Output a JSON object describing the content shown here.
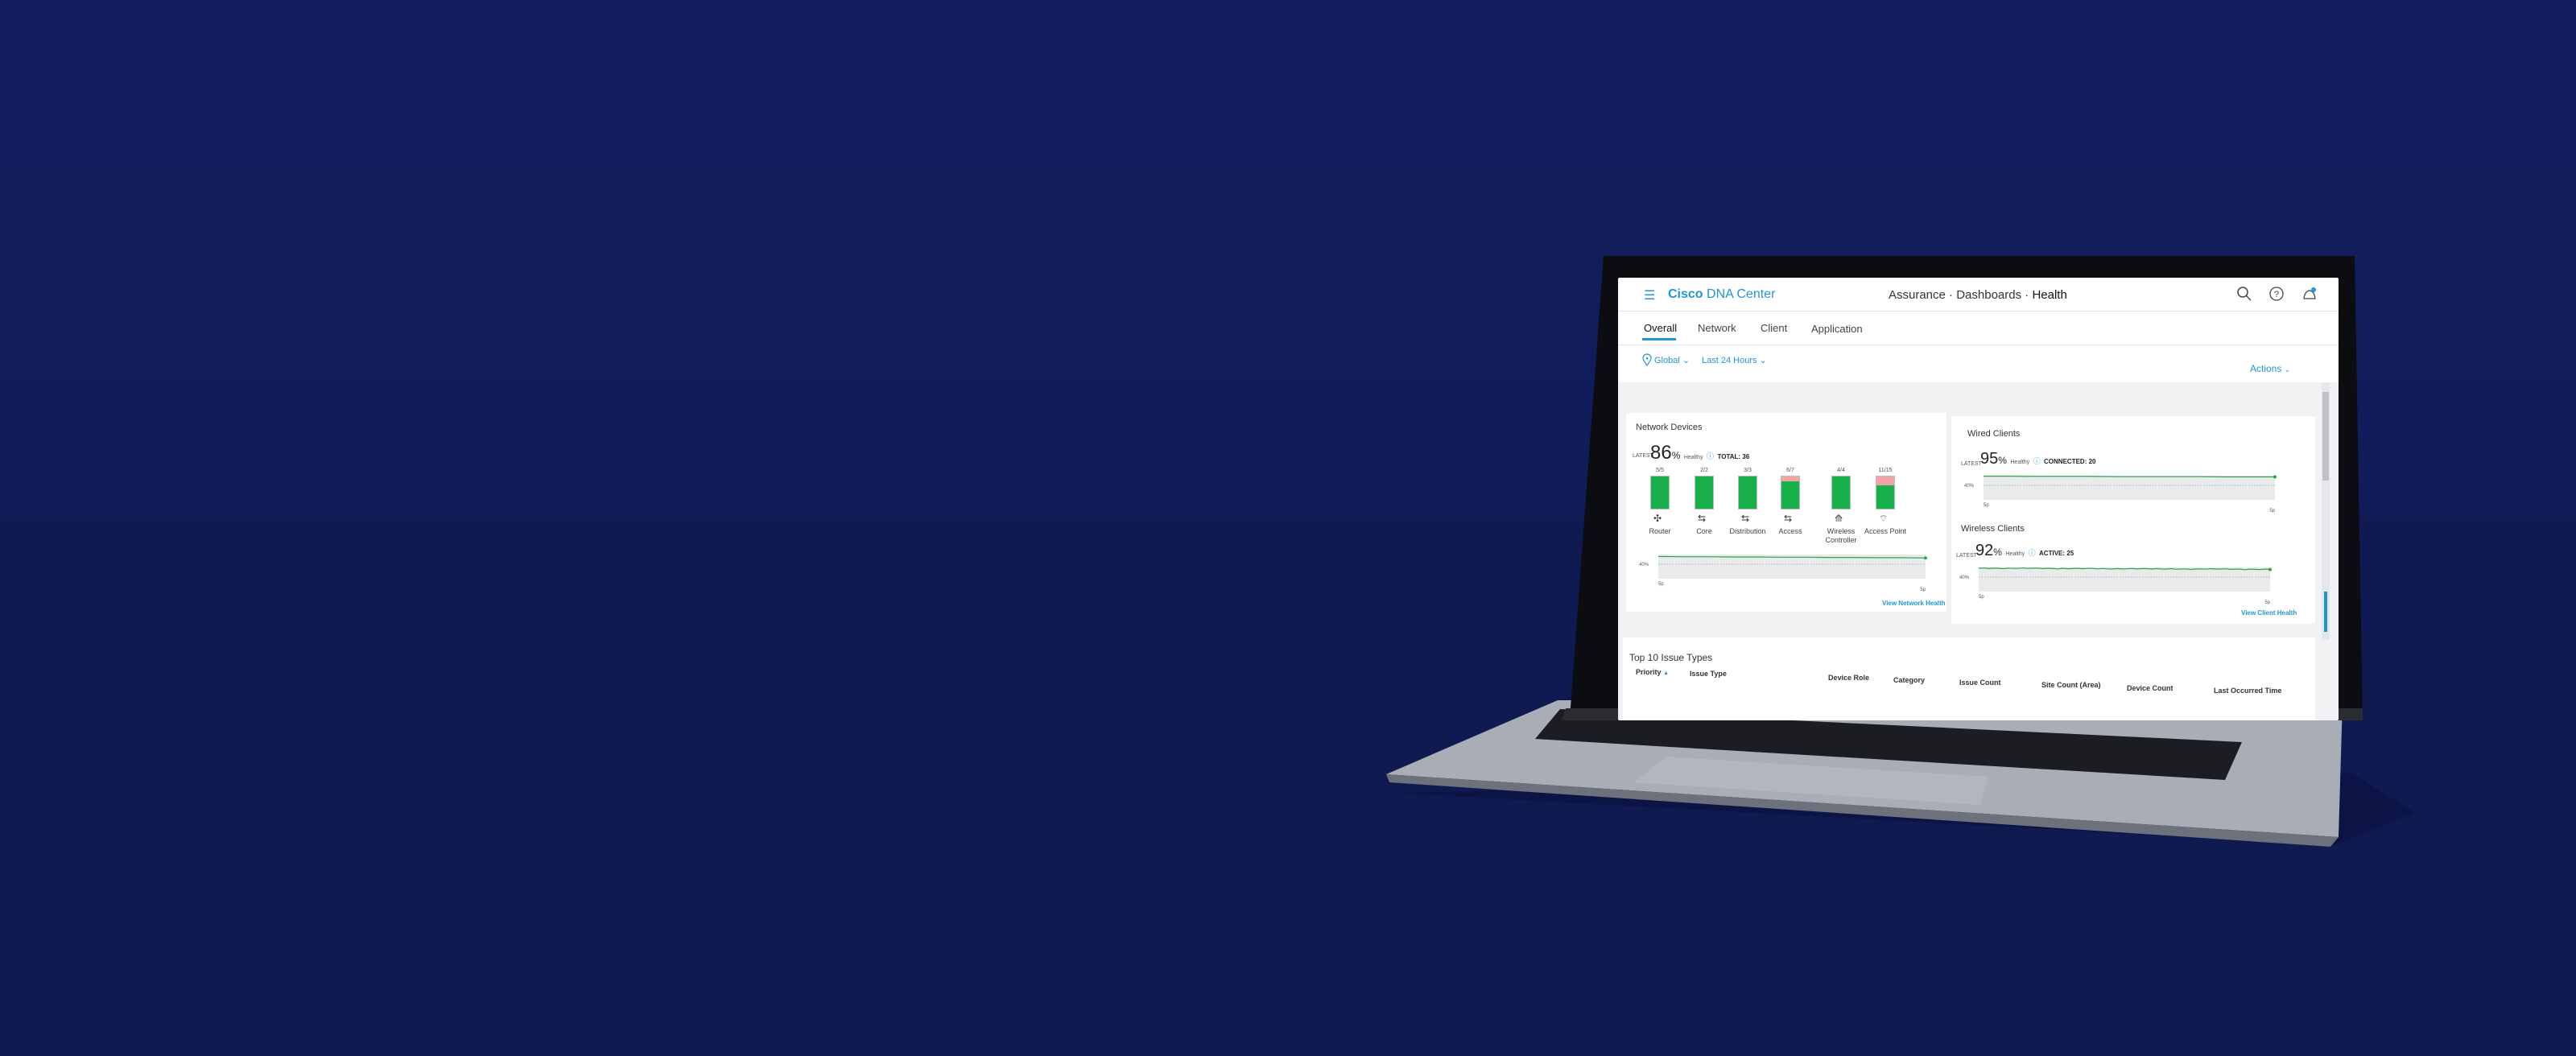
{
  "header": {
    "menu_icon": "hamburger-icon",
    "brand_bold": "Cisco",
    "brand_rest": "DNA Center",
    "breadcrumb": [
      "Assurance",
      "Dashboards",
      "Health"
    ],
    "breadcrumb_sep": "·",
    "icons": [
      "search-icon",
      "help-icon",
      "notification-icon"
    ]
  },
  "tabs": [
    {
      "label": "Overall",
      "active": true
    },
    {
      "label": "Network",
      "active": false
    },
    {
      "label": "Client",
      "active": false
    },
    {
      "label": "Application",
      "active": false
    }
  ],
  "filters": {
    "location": "Global",
    "time_range": "Last 24 Hours",
    "actions": "Actions"
  },
  "colors": {
    "accent": "#1e96d2",
    "healthy": "#18b04a",
    "unhealthy": "#f2a3a6",
    "background": "#121e5e"
  },
  "network_devices": {
    "title": "Network Devices",
    "latest_label": "LATEST",
    "health_value": "86",
    "percent_sign": "%",
    "healthy_label": "Healthy",
    "total": "TOTAL: 36",
    "categories": [
      {
        "label": "Router",
        "healthy": 5,
        "total": 5,
        "fraction": "5/5",
        "icon": "router-icon"
      },
      {
        "label": "Core",
        "healthy": 2,
        "total": 2,
        "fraction": "2/2",
        "icon": "switch-icon"
      },
      {
        "label": "Distribution",
        "healthy": 3,
        "total": 3,
        "fraction": "3/3",
        "icon": "switch-icon"
      },
      {
        "label": "Access",
        "healthy": 6,
        "total": 7,
        "fraction": "6/7",
        "icon": "switch-icon"
      },
      {
        "label": "Wireless Controller",
        "healthy": 4,
        "total": 4,
        "fraction": "4/4",
        "icon": "wireless-controller-icon"
      },
      {
        "label": "Access Point",
        "healthy": 11,
        "total": 15,
        "fraction": "11/15",
        "icon": "wifi-icon"
      }
    ],
    "trend": {
      "threshold_label": "40%",
      "start_label": "5p",
      "end_label": "5p",
      "values": [
        92,
        91,
        91,
        90,
        90,
        89,
        89,
        88,
        88,
        87,
        87,
        86
      ]
    },
    "link": "View Network Health"
  },
  "wired_clients": {
    "title": "Wired Clients",
    "latest_label": "LATEST",
    "health_value": "95",
    "percent_sign": "%",
    "healthy_label": "Healthy",
    "count": "CONNECTED: 20",
    "trend": {
      "threshold_label": "40%",
      "start_label": "5p",
      "end_label": "5p",
      "values": [
        98,
        98,
        97,
        97,
        97,
        96,
        96,
        96,
        96,
        95,
        95,
        95
      ]
    }
  },
  "wireless_clients": {
    "title": "Wireless Clients",
    "latest_label": "LATEST",
    "health_value": "92",
    "percent_sign": "%",
    "healthy_label": "Healthy",
    "count": "ACTIVE: 25",
    "trend": {
      "threshold_label": "40%",
      "start_label": "5p",
      "end_label": "5p",
      "values": [
        97,
        96,
        97,
        95,
        96,
        94,
        95,
        94,
        93,
        94,
        92,
        92
      ]
    },
    "link": "View Client Health"
  },
  "issues": {
    "title": "Top 10 Issue Types",
    "columns": [
      "Priority",
      "Issue Type",
      "Device Role",
      "Category",
      "Issue Count",
      "Site Count (Area)",
      "Device Count",
      "Last Occurred Time"
    ]
  }
}
